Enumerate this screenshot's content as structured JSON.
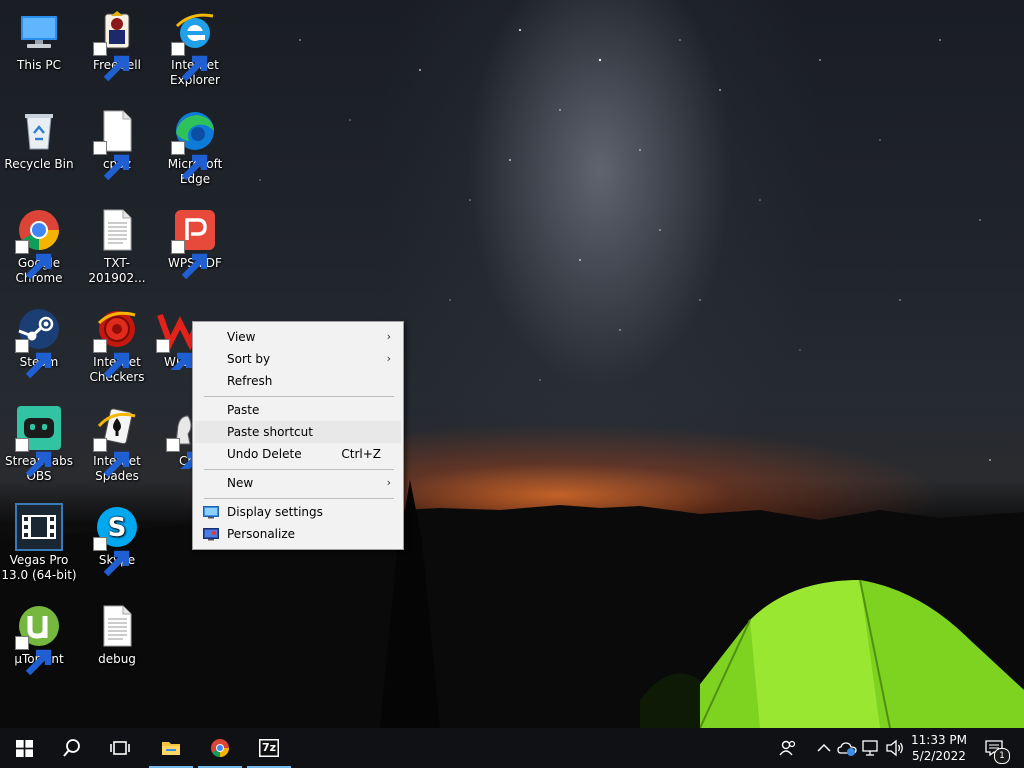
{
  "desktop": {
    "icons": [
      {
        "label": "This PC",
        "icon": "this-pc-icon"
      },
      {
        "label": "FreeCell",
        "icon": "freecell-icon"
      },
      {
        "label": "Internet Explorer",
        "icon": "internet-explorer-icon"
      },
      {
        "label": "Recycle Bin",
        "icon": "recycle-bin-icon"
      },
      {
        "label": "cpuz",
        "icon": "blank-file-icon"
      },
      {
        "label": "Microsoft Edge",
        "icon": "edge-icon"
      },
      {
        "label": "Google Chrome",
        "icon": "chrome-icon"
      },
      {
        "label": "TXT-201902...",
        "icon": "text-file-icon"
      },
      {
        "label": "WPS PDF",
        "icon": "wps-pdf-icon"
      },
      {
        "label": "Steam",
        "icon": "steam-icon"
      },
      {
        "label": "Internet Checkers",
        "icon": "checkers-icon"
      },
      {
        "label": "WPS",
        "icon": "wps-icon"
      },
      {
        "label": "Streamlabs OBS",
        "icon": "streamlabs-icon"
      },
      {
        "label": "Internet Spades",
        "icon": "spades-icon"
      },
      {
        "label": "Ch",
        "icon": "chess-icon"
      },
      {
        "label": "Vegas Pro 13.0 (64-bit)",
        "icon": "vegas-icon"
      },
      {
        "label": "Skype",
        "icon": "skype-icon"
      },
      {
        "label": "µTorrent",
        "icon": "utorrent-icon"
      },
      {
        "label": "debug",
        "icon": "text-file-icon"
      }
    ]
  },
  "context_menu": {
    "view": "View",
    "sort_by": "Sort by",
    "refresh": "Refresh",
    "paste": "Paste",
    "paste_shortcut": "Paste shortcut",
    "undo_delete": "Undo Delete",
    "undo_delete_shortcut": "Ctrl+Z",
    "new": "New",
    "display_settings": "Display settings",
    "personalize": "Personalize",
    "chevron": "›"
  },
  "taskbar": {
    "pinned": [
      "start-icon",
      "search-icon",
      "task-view-icon",
      "file-explorer-icon",
      "chrome-icon",
      "7zip-icon"
    ],
    "seven_zip_label": "7z",
    "time": "11:33 PM",
    "date": "5/2/2022",
    "notification_count": "1",
    "accent": "#76b9ed"
  }
}
